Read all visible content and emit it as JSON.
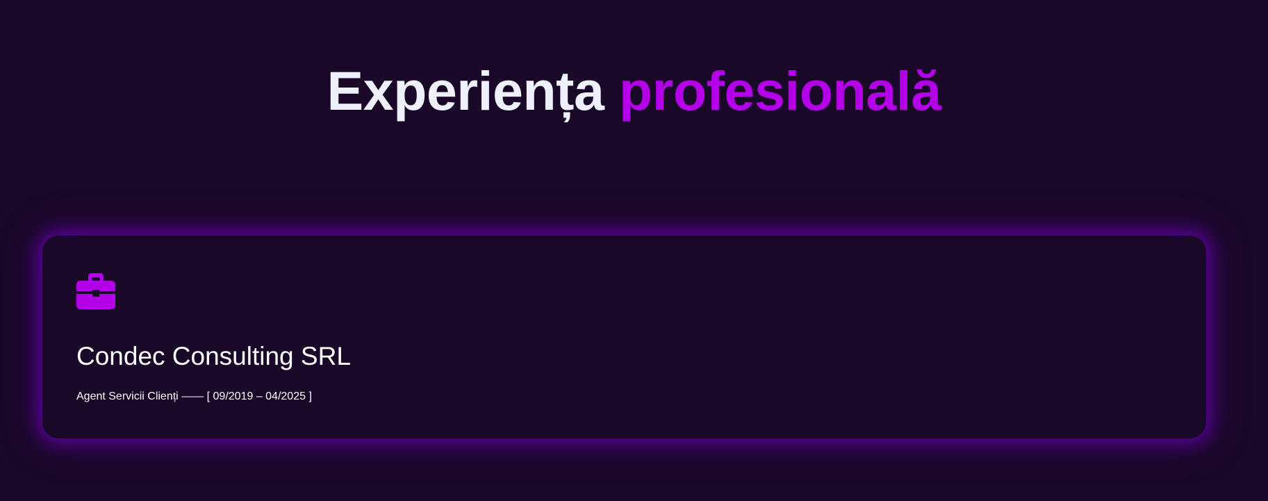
{
  "section": {
    "title_part1": "Experiența",
    "title_part2": "profesională"
  },
  "experience": [
    {
      "icon": "briefcase-icon",
      "company": "Condec Consulting SRL",
      "role": "Agent Servicii Clienți",
      "separator": "——",
      "period": "[ 09/2019 – 04/2025 ]"
    }
  ],
  "colors": {
    "background": "#1a0828",
    "accent": "#b400e8",
    "title_text": "#eef0fb",
    "text": "#ffffff"
  }
}
